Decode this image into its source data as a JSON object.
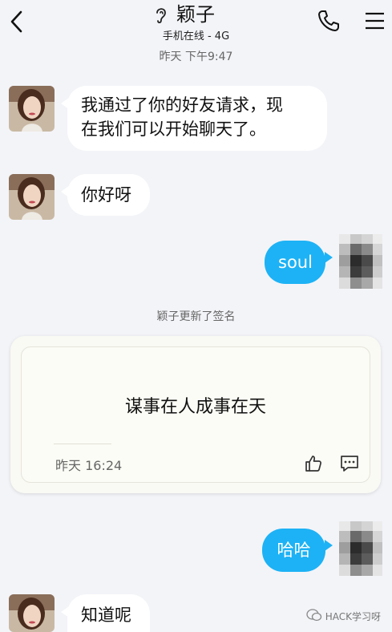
{
  "header": {
    "contact_name": "颖子",
    "status": "手机在线 - 4G"
  },
  "messages": {
    "timestamp": "昨天 下午9:47",
    "incoming_1": {
      "line1": "我通过了你的好友请求，现",
      "line2": "在我们可以开始聊天了。"
    },
    "incoming_2": "你好呀",
    "outgoing_1": "soul",
    "system_notice": "颖子更新了签名",
    "outgoing_2": "哈哈",
    "incoming_3": "知道呢"
  },
  "signature_card": {
    "text": "谋事在人成事在天",
    "time": "昨天 16:24"
  },
  "watermark": "HACK学习呀",
  "icons": {
    "back": "back-chevron-icon",
    "ear": "ear-icon",
    "call": "phone-icon",
    "menu": "menu-icon",
    "like": "thumbs-up-icon",
    "comment": "comment-icon"
  },
  "colors": {
    "background": "#f3f4f8",
    "outgoing_bubble": "#1db2f5",
    "incoming_bubble": "#ffffff"
  }
}
